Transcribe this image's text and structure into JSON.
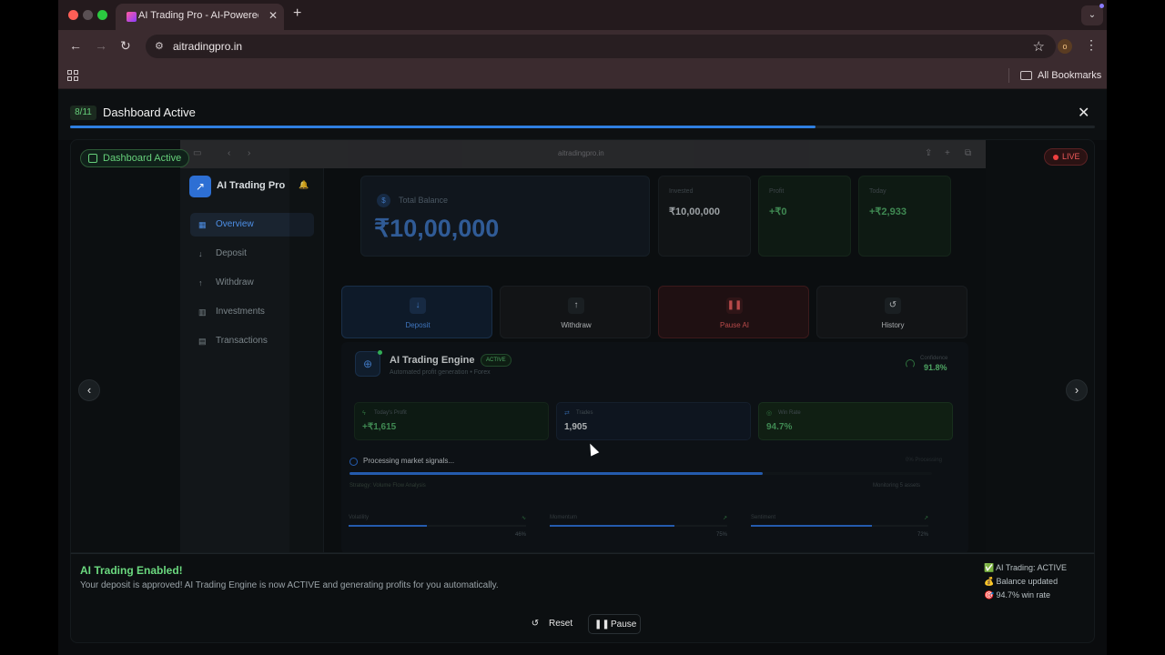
{
  "browser": {
    "tab_title": "AI Trading Pro - AI-Powered I",
    "url": "aitradingpro.in",
    "profile_initial": "o",
    "bookmarks_label": "All Bookmarks"
  },
  "tour": {
    "step": "8/11",
    "title": "Dashboard Active",
    "progress": 0.727
  },
  "stage": {
    "badge": "Dashboard Active",
    "live": "LIVE",
    "inner_url": "aitradingpro.in"
  },
  "app": {
    "title": "AI Trading Pro",
    "nav": [
      {
        "label": "Overview",
        "icon": "grid-icon",
        "active": true
      },
      {
        "label": "Deposit",
        "icon": "download-icon",
        "active": false
      },
      {
        "label": "Withdraw",
        "icon": "upload-icon",
        "active": false
      },
      {
        "label": "Investments",
        "icon": "bar-chart-icon",
        "active": false
      },
      {
        "label": "Transactions",
        "icon": "receipt-icon",
        "active": false
      }
    ],
    "balance": {
      "label": "Total Balance",
      "value": "₹10,00,000"
    },
    "mini_stats": [
      {
        "label": "Invested",
        "value": "₹10,00,000"
      },
      {
        "label": "Profit",
        "value": "+₹0"
      },
      {
        "label": "Today",
        "value": "+₹2,933"
      }
    ],
    "actions": [
      {
        "label": "Deposit"
      },
      {
        "label": "Withdraw"
      },
      {
        "label": "Pause AI"
      },
      {
        "label": "History"
      }
    ],
    "engine": {
      "title": "AI Trading Engine",
      "badge": "ACTIVE",
      "subtitle": "Automated profit generation • Forex",
      "confidence_label": "Confidence",
      "confidence_value": "91.8%",
      "stats": [
        {
          "label": "Today's Profit",
          "value": "+₹1,615"
        },
        {
          "label": "Trades",
          "value": "1,905"
        },
        {
          "label": "Win Rate",
          "value": "94.7%"
        }
      ],
      "processing": "Processing market signals...",
      "processing_right": "0% Processing",
      "processing_progress": 0.71,
      "strategy": "Strategy: Volume Flow Analysis",
      "monitoring": "Monitoring 5 assets",
      "meters": [
        {
          "label": "Volatility",
          "percent": "46%",
          "value": 0.44
        },
        {
          "label": "Momentum",
          "percent": "75%",
          "value": 0.7
        },
        {
          "label": "Sentiment",
          "percent": "72%",
          "value": 0.68
        }
      ]
    }
  },
  "footer": {
    "title": "AI Trading Enabled!",
    "description": "Your deposit is approved! AI Trading Engine is now ACTIVE and generating profits for you automatically.",
    "checklist": [
      {
        "emoji": "✅",
        "text": "AI Trading: ACTIVE"
      },
      {
        "emoji": "💰",
        "text": "Balance updated"
      },
      {
        "emoji": "🎯",
        "text": "94.7% win rate"
      }
    ],
    "reset_label": "Reset",
    "pause_label": "Pause"
  },
  "colors": {
    "accent_blue": "#2f7fe0",
    "success_green": "#66d07a",
    "danger_red": "#f05a5a"
  }
}
